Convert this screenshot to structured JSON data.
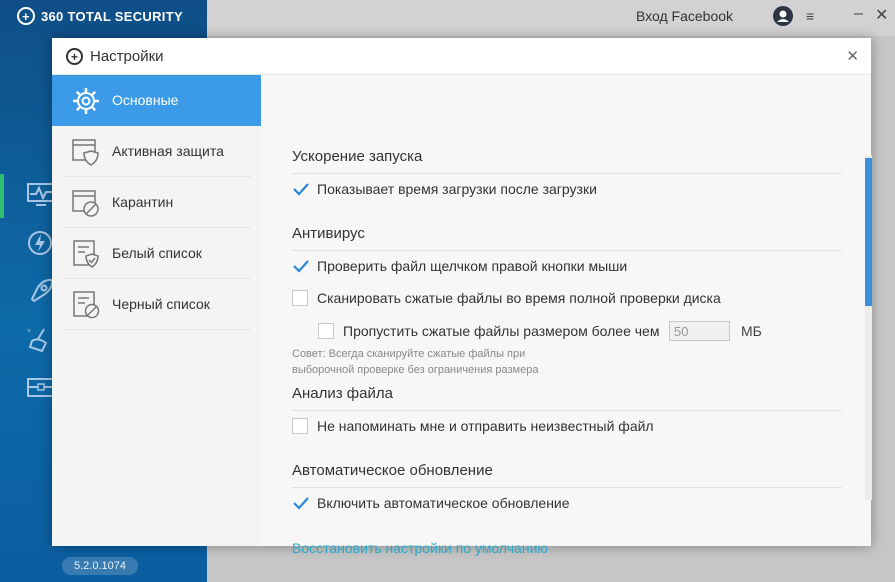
{
  "app": {
    "brand": "360 TOTAL SECURITY",
    "facebook_login": "Вход Facebook",
    "version": "5.2.0.1074",
    "colors": {
      "accent": "#3c9be8",
      "brand_blue": "#0d5f9e",
      "link": "#2aa9c9",
      "active_indicator": "#2fbf71"
    }
  },
  "dialog": {
    "title": "Настройки",
    "nav": [
      {
        "label": "Основные",
        "icon": "gear-icon",
        "active": true
      },
      {
        "label": "Активная защита",
        "icon": "shield-window-icon",
        "active": false
      },
      {
        "label": "Карантин",
        "icon": "quarantine-window-icon",
        "active": false
      },
      {
        "label": "Белый список",
        "icon": "whitelist-icon",
        "active": false
      },
      {
        "label": "Черный список",
        "icon": "blacklist-icon",
        "active": false
      }
    ],
    "sections": {
      "startup": {
        "title": "Ускорение запуска",
        "options": [
          {
            "label": "Показывает время загрузки после загрузки",
            "checked": true
          }
        ]
      },
      "antivirus": {
        "title": "Антивирус",
        "options": [
          {
            "label": "Проверить файл щелчком правой кнопки мыши",
            "checked": true
          },
          {
            "label": "Сканировать сжатые файлы во время полной проверки диска",
            "checked": false
          },
          {
            "label": "Пропустить сжатые файлы размером более чем",
            "checked": false
          }
        ],
        "size_value": "50",
        "size_unit": "МБ",
        "tip_line1": "Совет: Всегда сканируйте сжатые файлы при",
        "tip_line2": "выборочной проверке без ограничения размера"
      },
      "file_analysis": {
        "title": "Анализ файла",
        "options": [
          {
            "label": "Не напоминать мне и отправить неизвестный файл",
            "checked": false
          }
        ]
      },
      "auto_update": {
        "title": "Автоматическое обновление",
        "options": [
          {
            "label": "Включить автоматическое обновление",
            "checked": true
          }
        ]
      }
    },
    "restore_defaults": "Восстановить настройки по умолчанию"
  }
}
